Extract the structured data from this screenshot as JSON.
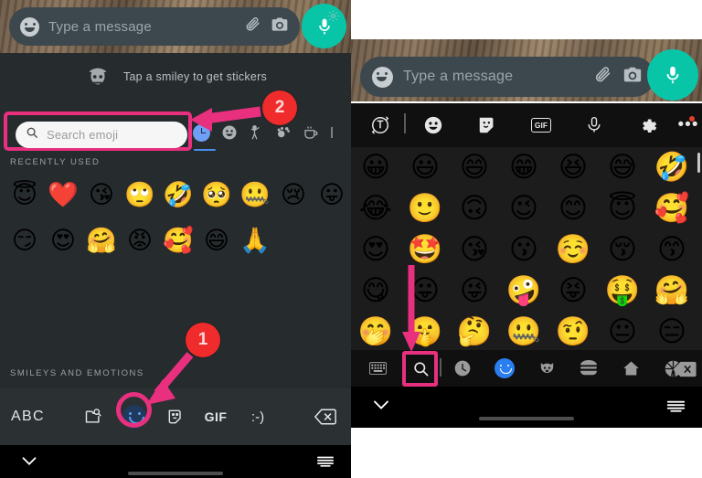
{
  "left_panel": {
    "message_bar": {
      "placeholder": "Type a message",
      "emoji_icon": "smiley-icon",
      "attach_icon": "paperclip-icon",
      "camera_icon": "camera-icon",
      "mic_icon": "microphone-icon",
      "mic_color": "#09c5a8",
      "bar_color": "#3c484d"
    },
    "sticker_hint": {
      "text": "Tap a smiley to get stickers",
      "art_icon": "sticker-character-icon",
      "settings_icon": "gear-icon"
    },
    "search": {
      "placeholder": "Search emoji",
      "icon": "search-icon",
      "highlight_color": "#e8307f"
    },
    "category_tabs": [
      {
        "name": "recent",
        "icon": "clock-icon",
        "active": true
      },
      {
        "name": "smileys",
        "icon": "smiley-icon",
        "active": false
      },
      {
        "name": "people",
        "icon": "person-raising-hand-icon",
        "active": false
      },
      {
        "name": "animals-nature",
        "icon": "paw-flower-icon",
        "active": false
      },
      {
        "name": "food-drink",
        "icon": "cup-icon",
        "active": false
      },
      {
        "name": "travel",
        "icon": "partial-icon",
        "active": false
      }
    ],
    "sections": {
      "recently_used_label": "RECENTLY USED",
      "smileys_label": "SMILEYS AND EMOTIONS"
    },
    "recently_used": [
      [
        "😇",
        "❤️",
        "😘",
        "🙄",
        "🤣",
        "🥺",
        "🤐",
        "😢",
        "😛"
      ],
      [
        "😏",
        "😍",
        "🤗",
        "😡",
        "🥰",
        "😄",
        "🙏"
      ]
    ],
    "keyboard_row": {
      "abc_label": "ABC",
      "image_search_icon": "image-search-icon",
      "smiley_icon": "smiley-icon",
      "sticker_icon": "sticker-icon",
      "gif_label": "GIF",
      "emoticon_label": ":-)",
      "backspace_icon": "backspace-icon",
      "active_smiley_color": "#5b9df0"
    },
    "nav_bar": {
      "back_icon": "chevron-down-icon",
      "keyboard_icon": "keyboard-icon"
    }
  },
  "right_panel": {
    "message_bar": {
      "placeholder": "Type a message",
      "emoji_icon": "smiley-icon",
      "attach_icon": "paperclip-icon",
      "camera_icon": "camera-icon",
      "mic_icon": "microphone-icon"
    },
    "toolbar": [
      {
        "name": "translate",
        "icon": "translate-icon"
      },
      {
        "name": "emoji",
        "icon": "smiley-icon"
      },
      {
        "name": "stickers",
        "icon": "sticker-icon"
      },
      {
        "name": "gif",
        "icon": "gif-icon",
        "label": "GIF"
      },
      {
        "name": "voice",
        "icon": "microphone-icon"
      },
      {
        "name": "settings",
        "icon": "gear-icon"
      },
      {
        "name": "more",
        "icon": "more-dots-icon",
        "has_badge": true
      }
    ],
    "emoji_grid": [
      [
        "😀",
        "😃",
        "😄",
        "😁",
        "😆",
        "😅",
        "🤣"
      ],
      [
        "😂",
        "🙂",
        "🙃",
        "😉",
        "😊",
        "😇",
        "🥰"
      ],
      [
        "😍",
        "🤩",
        "😘",
        "😗",
        "☺️",
        "😚",
        "😙"
      ],
      [
        "😋",
        "😛",
        "😜",
        "🤪",
        "😝",
        "🤑",
        "🤗"
      ],
      [
        "🤭",
        "🤫",
        "🤔",
        "🤐",
        "🤨",
        "😐",
        "😑"
      ]
    ],
    "bottom_bar": [
      {
        "name": "keyboard",
        "icon": "keyboard-icon"
      },
      {
        "name": "search",
        "icon": "search-icon",
        "highlighted": true
      },
      {
        "name": "recent",
        "icon": "clock-icon"
      },
      {
        "name": "smileys",
        "icon": "smiley-icon",
        "active": true
      },
      {
        "name": "animals",
        "icon": "dog-face-icon"
      },
      {
        "name": "food",
        "icon": "burger-icon"
      },
      {
        "name": "travel",
        "icon": "house-icon"
      },
      {
        "name": "activity",
        "icon": "basketball-icon"
      },
      {
        "name": "backspace",
        "icon": "backspace-icon"
      }
    ],
    "highlight_color": "#e8307f",
    "nav_bar": {
      "back_icon": "chevron-down-icon",
      "keyboard_icon": "keyboard-icon"
    }
  },
  "annotations": {
    "badges": [
      {
        "id": "1",
        "label": "1",
        "color": "#ef2b2b",
        "points_to": "emoji-keyboard-button"
      },
      {
        "id": "2",
        "label": "2",
        "color": "#e8307f",
        "points_to": "search-emoji-field"
      }
    ],
    "arrow_color": "#e8307f"
  }
}
